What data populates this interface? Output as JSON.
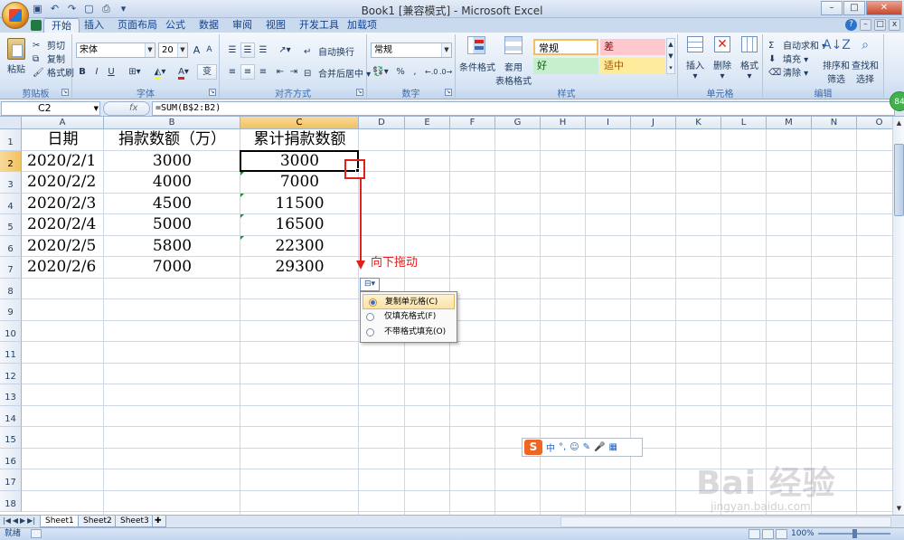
{
  "window": {
    "title": "Book1 [兼容模式] - Microsoft Excel",
    "minimize": "–",
    "maximize": "□",
    "close": "✕"
  },
  "tabs": [
    "开始",
    "插入",
    "页面布局",
    "公式",
    "数据",
    "审阅",
    "视图",
    "开发工具",
    "加载项"
  ],
  "active_tab": "开始",
  "ribbon": {
    "clipboard": {
      "label": "剪贴板",
      "paste": "粘贴",
      "cut": "剪切",
      "copy": "复制",
      "format_painter": "格式刷"
    },
    "font": {
      "label": "字体",
      "name": "宋体",
      "size": "20",
      "bold": "B",
      "italic": "I",
      "underline": "U",
      "grow": "A",
      "shrink": "A",
      "wen": "变"
    },
    "alignment": {
      "label": "对齐方式",
      "wrap": "自动换行",
      "merge": "合并后居中"
    },
    "number": {
      "label": "数字",
      "format": "常规",
      "percent": "%",
      "comma": ","
    },
    "styles": {
      "label": "样式",
      "conditional": "条件格式",
      "table": "套用",
      "table2": "表格格式",
      "cell_styles": [
        "常规",
        "差",
        "好",
        "适中"
      ]
    },
    "cells": {
      "label": "单元格",
      "insert": "插入",
      "delete": "删除",
      "format": "格式"
    },
    "editing": {
      "label": "编辑",
      "autosum": "自动求和",
      "fill": "填充",
      "clear": "清除",
      "sort": "排序和",
      "sort2": "筛选",
      "find": "查找和",
      "find2": "选择"
    }
  },
  "formula_bar": {
    "name_box": "C2",
    "fx": "fx",
    "formula": "=SUM(B$2:B2)"
  },
  "columns": [
    "A",
    "B",
    "C",
    "D",
    "E",
    "F",
    "G",
    "H",
    "I",
    "J",
    "K",
    "L",
    "M",
    "N",
    "O"
  ],
  "rows": [
    "1",
    "2",
    "3",
    "4",
    "5",
    "6",
    "7",
    "8",
    "9",
    "10",
    "11",
    "12",
    "13",
    "14",
    "15",
    "16",
    "17",
    "18"
  ],
  "sheet": {
    "headers": {
      "a": "日期",
      "b": "捐款数额（万）",
      "c": "累计捐款数额"
    },
    "data": [
      {
        "date": "2020/2/1",
        "amount": "3000",
        "cumulative": "3000"
      },
      {
        "date": "2020/2/2",
        "amount": "4000",
        "cumulative": "7000"
      },
      {
        "date": "2020/2/3",
        "amount": "4500",
        "cumulative": "11500"
      },
      {
        "date": "2020/2/4",
        "amount": "5000",
        "cumulative": "16500"
      },
      {
        "date": "2020/2/5",
        "amount": "5800",
        "cumulative": "22300"
      },
      {
        "date": "2020/2/6",
        "amount": "7000",
        "cumulative": "29300"
      }
    ]
  },
  "annotation": "向下拖动",
  "autofill_options": {
    "items": [
      "复制单元格(C)",
      "仅填充格式(F)",
      "不带格式填充(O)"
    ],
    "selected": 0
  },
  "ime": {
    "mode": "中",
    "punct": "°,",
    "items": [
      "☺",
      "✎",
      "🎤",
      "▦"
    ]
  },
  "sheets": [
    "Sheet1",
    "Sheet2",
    "Sheet3"
  ],
  "active_sheet": "Sheet1",
  "status": {
    "ready": "就绪",
    "zoom": "100%"
  },
  "watermark": {
    "text": "Bai 经验",
    "url": "jingyan.baidu.com"
  },
  "badge": "84"
}
